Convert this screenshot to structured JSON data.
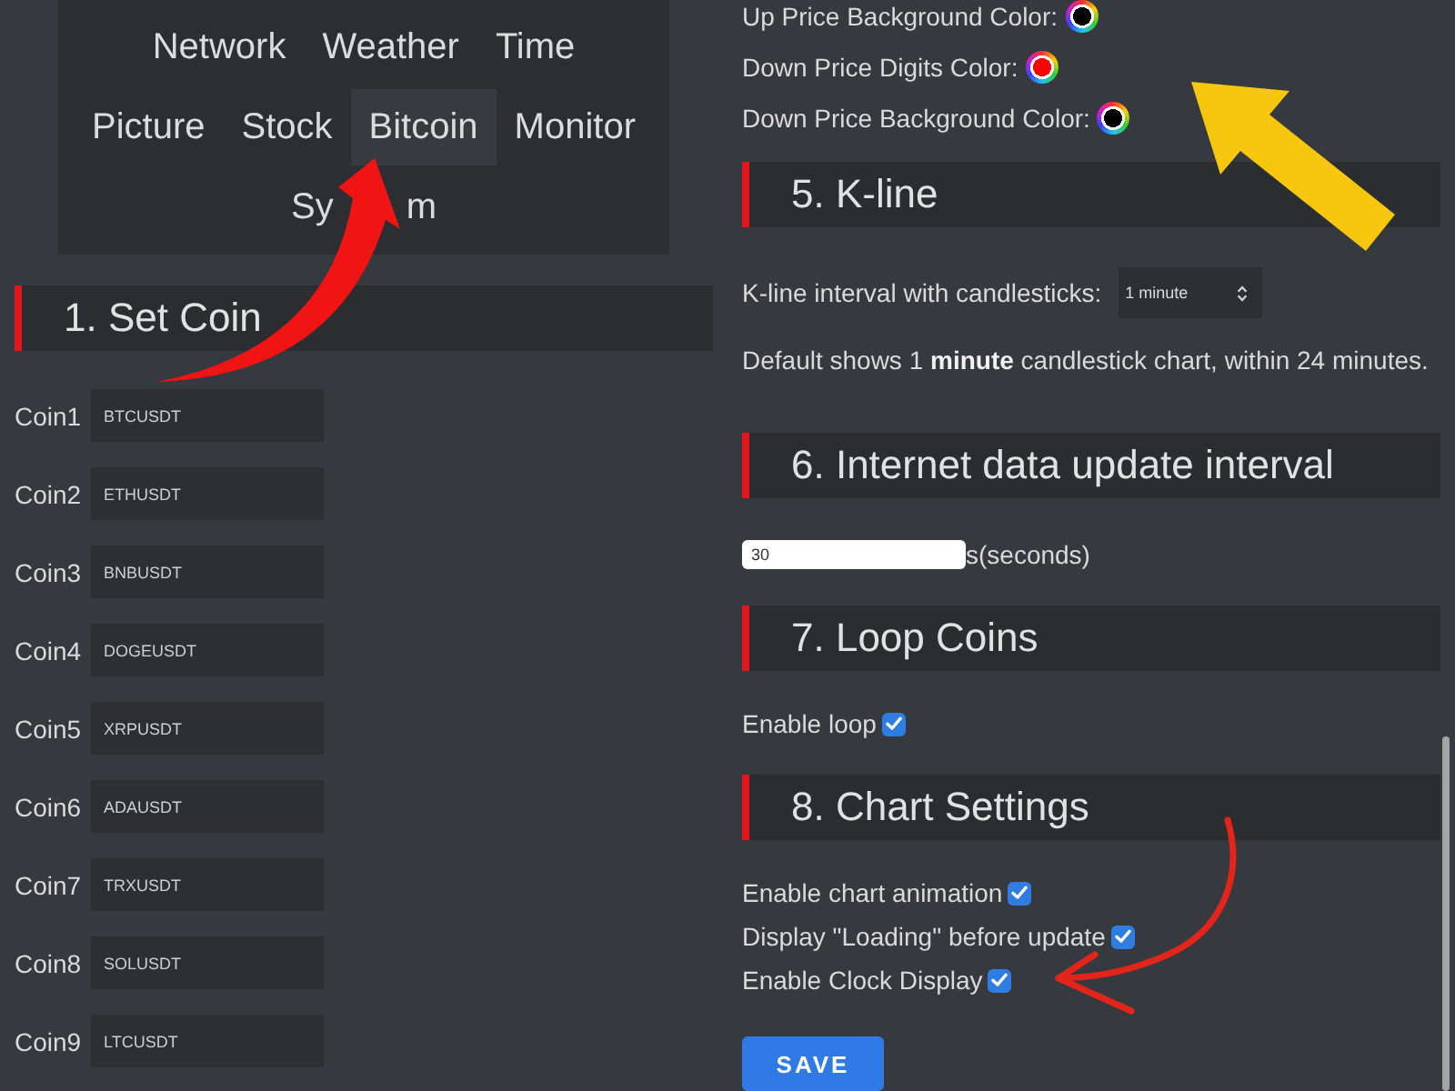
{
  "nav": {
    "rows": [
      {
        "tabs": [
          {
            "label": "Network",
            "selected": false
          },
          {
            "label": "Weather",
            "selected": false
          },
          {
            "label": "Time",
            "selected": false
          }
        ]
      },
      {
        "tabs": [
          {
            "label": "Picture",
            "selected": false
          },
          {
            "label": "Stock",
            "selected": false
          },
          {
            "label": "Bitcoin",
            "selected": true
          },
          {
            "label": "Monitor",
            "selected": false
          }
        ]
      },
      {
        "tabs": [
          {
            "visible_parts": [
              "Sy",
              "m"
            ],
            "selected": false
          }
        ]
      }
    ]
  },
  "set_coin": {
    "heading": "1. Set Coin",
    "coins": [
      {
        "label": "Coin1",
        "value": "BTCUSDT"
      },
      {
        "label": "Coin2",
        "value": "ETHUSDT"
      },
      {
        "label": "Coin3",
        "value": "BNBUSDT"
      },
      {
        "label": "Coin4",
        "value": "DOGEUSDT"
      },
      {
        "label": "Coin5",
        "value": "XRPUSDT"
      },
      {
        "label": "Coin6",
        "value": "ADAUSDT"
      },
      {
        "label": "Coin7",
        "value": "TRXUSDT"
      },
      {
        "label": "Coin8",
        "value": "SOLUSDT"
      },
      {
        "label": "Coin9",
        "value": "LTCUSDT"
      }
    ]
  },
  "price_colors": [
    {
      "label": "Up Price Background Color:",
      "color": "#000000"
    },
    {
      "label": "Down Price Digits Color:",
      "color": "#ff0000"
    },
    {
      "label": "Down Price Background Color:",
      "color": "#000000"
    }
  ],
  "kline": {
    "heading": "5. K-line",
    "label": "K-line interval with candlesticks:",
    "select": {
      "value": "1 minute"
    },
    "note": "Default shows 1 **minute** candlestick chart, within 24 minutes."
  },
  "update_interval": {
    "heading": "6. Internet data update interval",
    "field": {
      "value": "30"
    },
    "unit": "s(seconds)"
  },
  "loop_coins": {
    "heading": "7. Loop Coins",
    "options": [
      {
        "label": "Enable loop",
        "checked": true
      }
    ]
  },
  "chart_settings": {
    "heading": "8. Chart Settings",
    "options": [
      {
        "label": "Enable chart animation",
        "checked": true
      },
      {
        "label": "Display \"Loading\" before update",
        "checked": true
      },
      {
        "label": "Enable Clock Display",
        "checked": true
      }
    ]
  },
  "save_button": {
    "label": "SAVE"
  },
  "annotations": [
    {
      "kind": "curved-arrow",
      "color": "#f01414"
    },
    {
      "kind": "block-arrow",
      "color": "#f7c70f"
    },
    {
      "kind": "hand-drawn-arrow",
      "color": "#e3241b"
    }
  ]
}
